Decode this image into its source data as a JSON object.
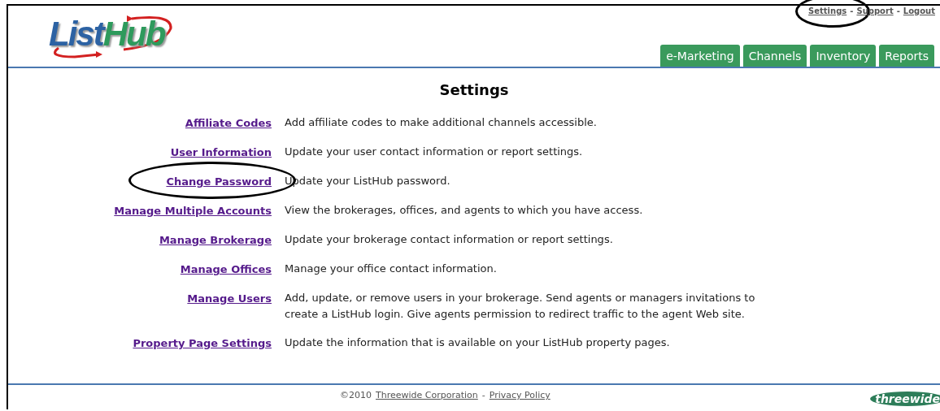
{
  "logo_text": [
    "List",
    "Hub"
  ],
  "top_nav": [
    {
      "kind": "link",
      "text": "Settings",
      "circled": true
    },
    {
      "kind": "separator",
      "text": "-",
      "circled": false
    },
    {
      "kind": "link",
      "text": "Support",
      "circled": false
    },
    {
      "kind": "separator",
      "text": "-",
      "circled": false
    },
    {
      "kind": "link",
      "text": "Logout",
      "circled": false
    }
  ],
  "tabs": [
    {
      "label": "e-Marketing"
    },
    {
      "label": "Channels"
    },
    {
      "label": "Inventory"
    },
    {
      "label": "Reports"
    }
  ],
  "title": "Settings",
  "settings": [
    {
      "link": "Affiliate Codes",
      "description": "Add affiliate codes to make additional channels accessible.",
      "circled": false
    },
    {
      "link": "User Information",
      "description": "Update your user contact information or report settings.",
      "circled": false
    },
    {
      "link": "Change Password",
      "description": "Update your ListHub password.",
      "circled": true
    },
    {
      "link": "Manage Multiple Accounts",
      "description": "View the brokerages, offices, and agents to which you have access.",
      "circled": false
    },
    {
      "link": "Manage Brokerage",
      "description": "Update your brokerage contact information or report settings.",
      "circled": false
    },
    {
      "link": "Manage Offices",
      "description": "Manage your office contact information.",
      "circled": false
    },
    {
      "link": "Manage Users",
      "description": "Add, update, or remove users in your brokerage. Send agents or managers invitations to create a ListHub login. Give agents permission to redirect traffic to the agent Web site.",
      "circled": false
    },
    {
      "link": "Property Page Settings",
      "description": "Update the information that is available on your ListHub property pages.",
      "circled": false
    }
  ],
  "footer": [
    {
      "kind": "text",
      "text": "©2010"
    },
    {
      "kind": "link",
      "text": "Threewide Corporation"
    },
    {
      "kind": "text",
      "text": "-"
    },
    {
      "kind": "link",
      "text": "Privacy Policy"
    }
  ],
  "footer_logo": "threewide"
}
